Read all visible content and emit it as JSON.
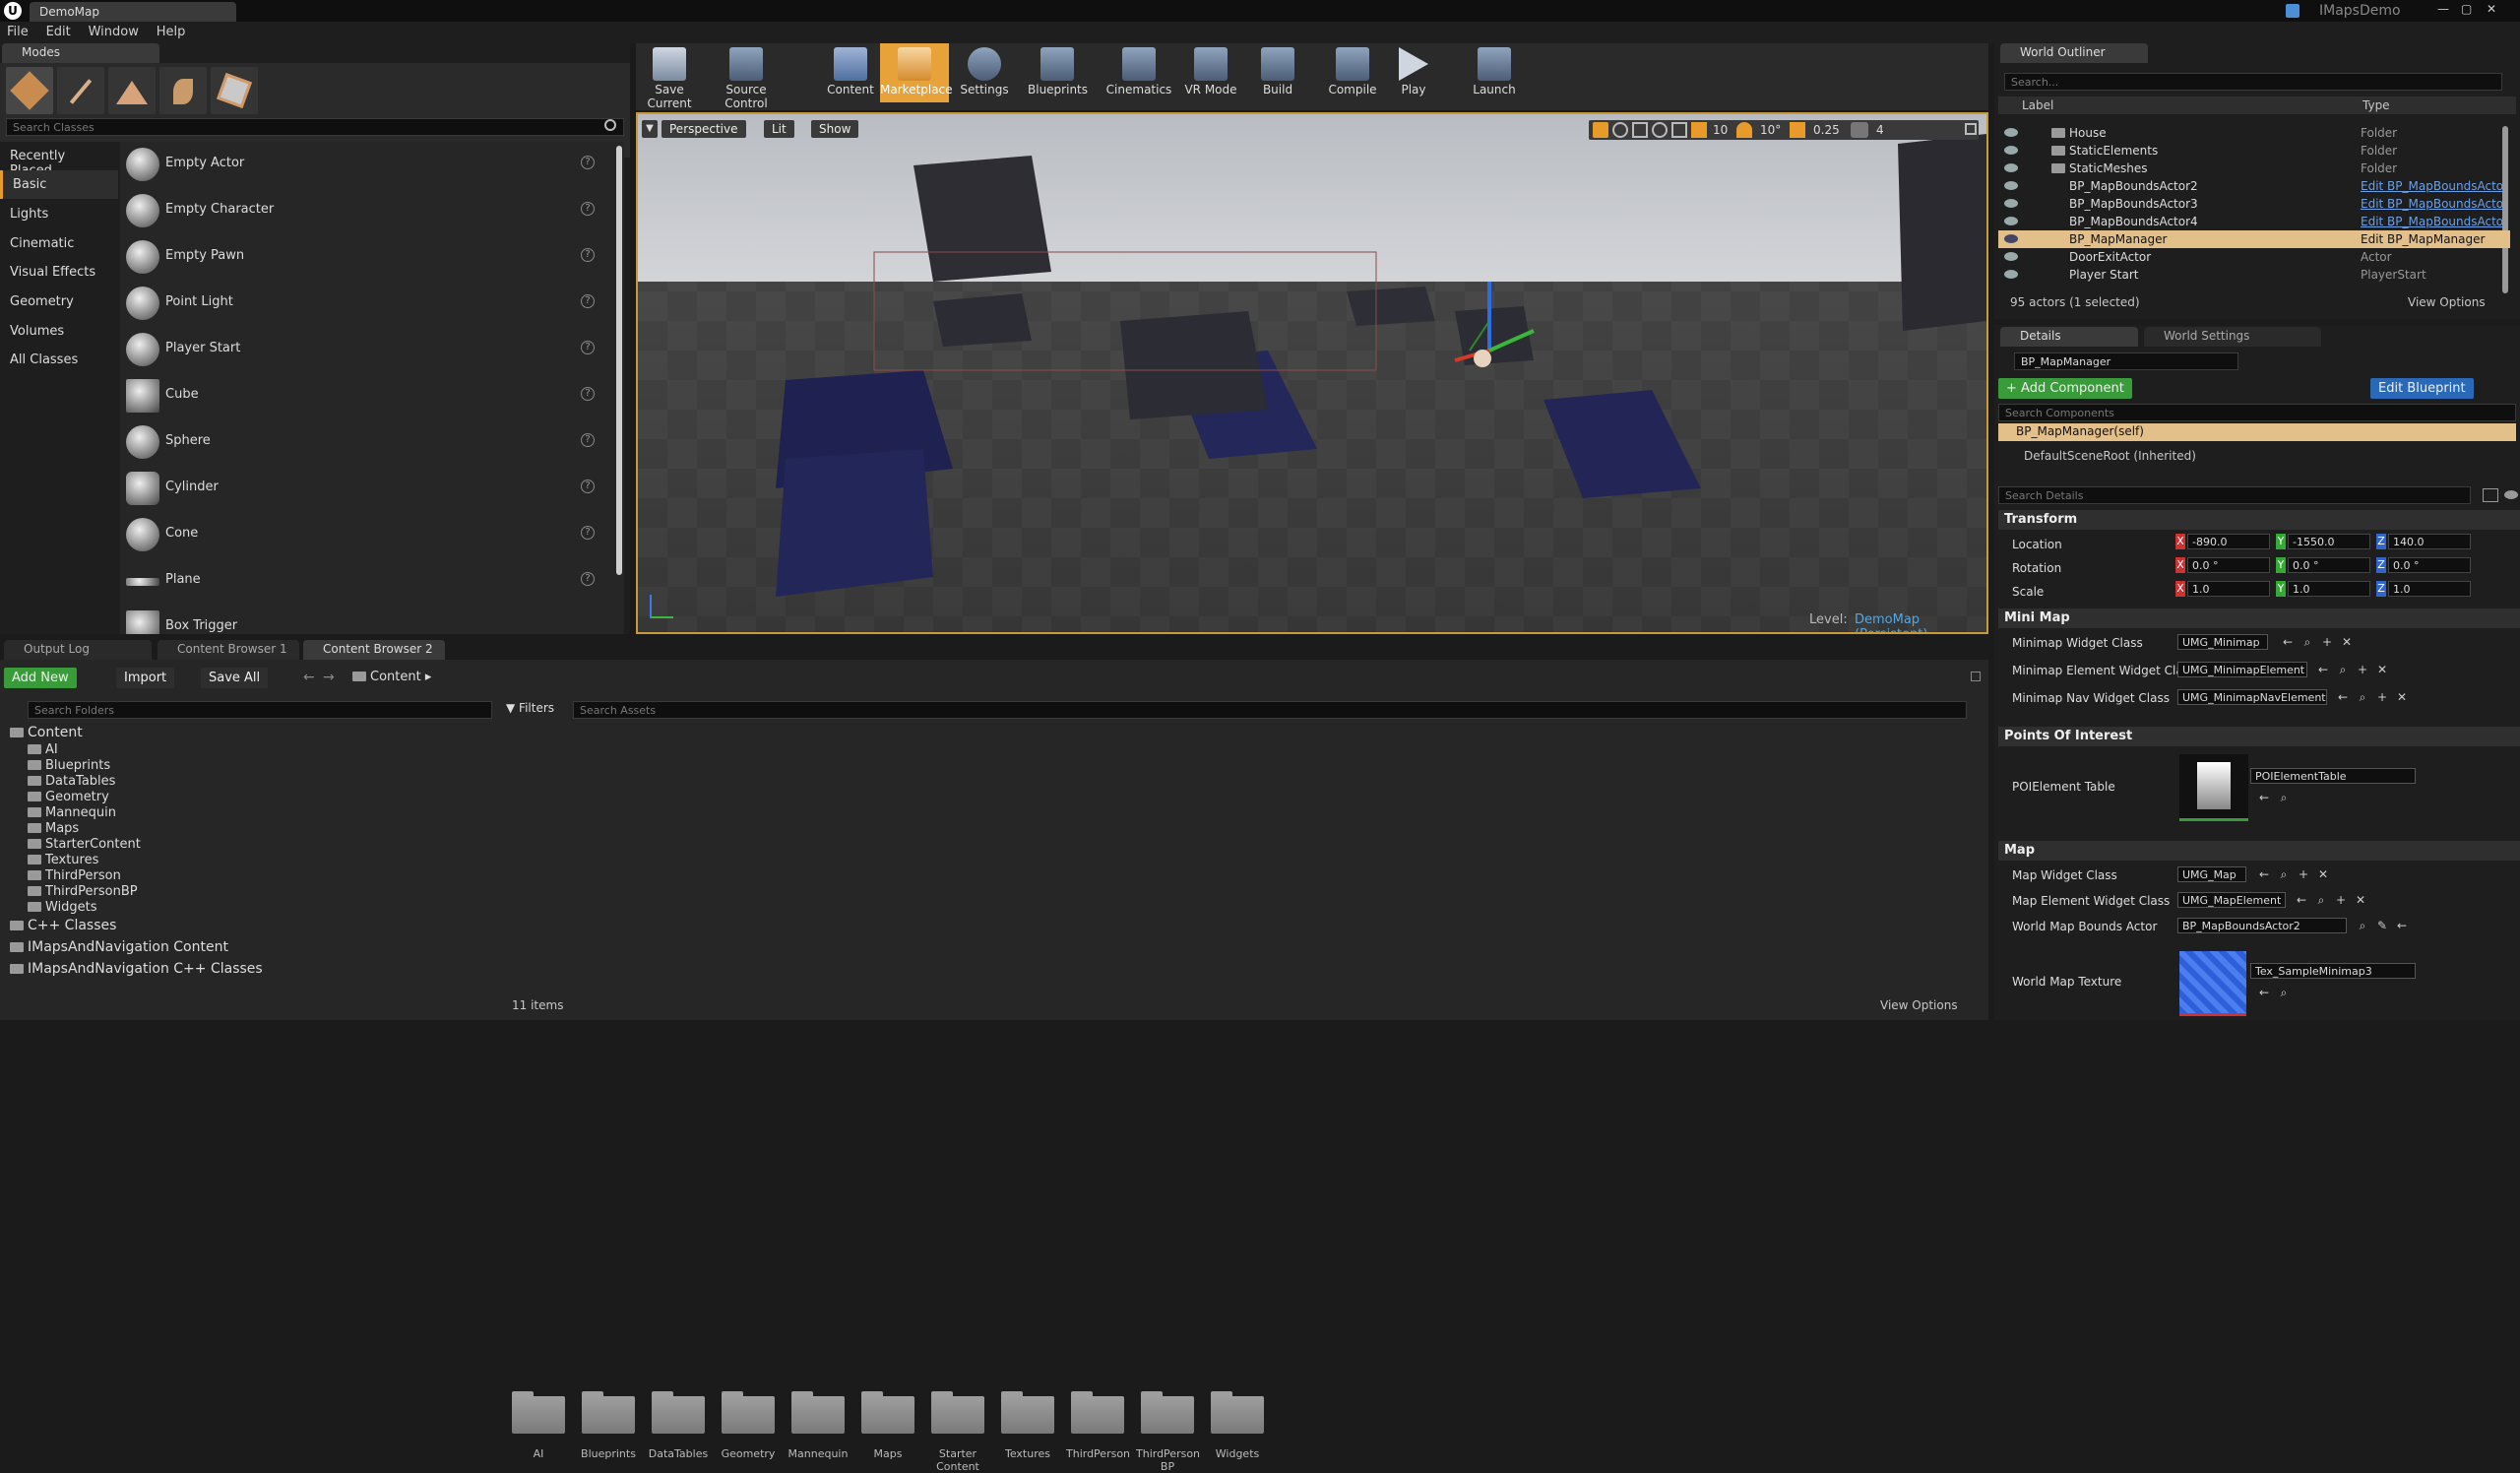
{
  "app": {
    "logo": "U",
    "tab_title": "DemoMap",
    "project_name": "IMapsDemo"
  },
  "menu": [
    "File",
    "Edit",
    "Window",
    "Help"
  ],
  "modes": {
    "tab": "Modes",
    "search_placeholder": "Search Classes",
    "categories": [
      "Recently Placed",
      "Basic",
      "Lights",
      "Cinematic",
      "Visual Effects",
      "Geometry",
      "Volumes",
      "All Classes"
    ],
    "items": [
      "Empty Actor",
      "Empty Character",
      "Empty Pawn",
      "Point Light",
      "Player Start",
      "Cube",
      "Sphere",
      "Cylinder",
      "Cone",
      "Plane",
      "Box Trigger"
    ]
  },
  "toolbar": [
    "Save Current",
    "Source Control",
    "Content",
    "Marketplace",
    "Settings",
    "Blueprints",
    "Cinematics",
    "VR Mode",
    "Build",
    "Compile",
    "Play",
    "Launch"
  ],
  "viewport": {
    "perspective": "Perspective",
    "lit": "Lit",
    "show": "Show",
    "grid_snap": "10",
    "rot_snap": "10°",
    "scale_snap": "0.25",
    "cam_speed": "4",
    "level_label": "Level:",
    "level_name": "DemoMap (Persistent)"
  },
  "outliner": {
    "tab": "World Outliner",
    "search_placeholder": "Search...",
    "col_label": "Label",
    "col_type": "Type",
    "rows": [
      {
        "name": "House",
        "type": "Folder",
        "link": false
      },
      {
        "name": "StaticElements",
        "type": "Folder",
        "link": false
      },
      {
        "name": "StaticMeshes",
        "type": "Folder",
        "link": false
      },
      {
        "name": "BP_MapBoundsActor2",
        "type": "Edit BP_MapBoundsActo",
        "link": true
      },
      {
        "name": "BP_MapBoundsActor3",
        "type": "Edit BP_MapBoundsActo",
        "link": true
      },
      {
        "name": "BP_MapBoundsActor4",
        "type": "Edit BP_MapBoundsActo",
        "link": true
      },
      {
        "name": "BP_MapManager",
        "type": "Edit BP_MapManager",
        "link": false
      },
      {
        "name": "DoorExitActor",
        "type": "Actor",
        "link": false
      },
      {
        "name": "Player Start",
        "type": "PlayerStart",
        "link": false
      }
    ],
    "status": "95 actors (1 selected)",
    "view_options": "View Options"
  },
  "details": {
    "tab": "Details",
    "tab2": "World Settings",
    "name": "BP_MapManager",
    "add_component": "+ Add Component",
    "edit_blueprint": "Edit Blueprint",
    "search_components": "Search Components",
    "self": "BP_MapManager(self)",
    "root": "DefaultSceneRoot (Inherited)",
    "search_details": "Search Details",
    "transform": {
      "title": "Transform",
      "location_label": "Location",
      "rotation_label": "Rotation",
      "scale_label": "Scale",
      "location": [
        "-890.0",
        "-1550.0",
        "140.0"
      ],
      "rotation": [
        "0.0 °",
        "0.0 °",
        "0.0 °"
      ],
      "scale": [
        "1.0",
        "1.0",
        "1.0"
      ]
    },
    "minimap": {
      "title": "Mini Map",
      "rows": [
        {
          "label": "Minimap Widget Class",
          "value": "UMG_Minimap"
        },
        {
          "label": "Minimap Element Widget Class",
          "value": "UMG_MinimapElement"
        },
        {
          "label": "Minimap Nav Widget Class",
          "value": "UMG_MinimapNavElement"
        }
      ]
    },
    "poi": {
      "title": "Points Of Interest",
      "label": "POIElement Table",
      "value": "POIElementTable"
    },
    "map": {
      "title": "Map",
      "rows": [
        {
          "label": "Map Widget Class",
          "value": "UMG_Map"
        },
        {
          "label": "Map Element Widget Class",
          "value": "UMG_MapElement"
        },
        {
          "label": "World Map Bounds Actor",
          "value": "BP_MapBoundsActor2"
        }
      ],
      "texture_label": "World Map Texture",
      "texture_value": "Tex_SampleMinimap3"
    }
  },
  "bottom_tabs": [
    "Output Log",
    "Content Browser 1",
    "Content Browser 2"
  ],
  "content": {
    "add_new": "Add New",
    "import": "Import",
    "save_all": "Save All",
    "path": "Content",
    "search_folders": "Search Folders",
    "filters": "Filters",
    "search_assets": "Search Assets",
    "tree": [
      "Content",
      "AI",
      "Blueprints",
      "DataTables",
      "Geometry",
      "Mannequin",
      "Maps",
      "StarterContent",
      "Textures",
      "ThirdPerson",
      "ThirdPersonBP",
      "Widgets",
      "C++ Classes",
      "IMapsAndNavigation Content",
      "IMapsAndNavigation C++ Classes"
    ],
    "assets": [
      "AI",
      "Blueprints",
      "DataTables",
      "Geometry",
      "Mannequin",
      "Maps",
      "Starter Content",
      "Textures",
      "ThirdPerson",
      "ThirdPerson BP",
      "Widgets"
    ],
    "count": "11 items",
    "view_options": "View Options"
  }
}
